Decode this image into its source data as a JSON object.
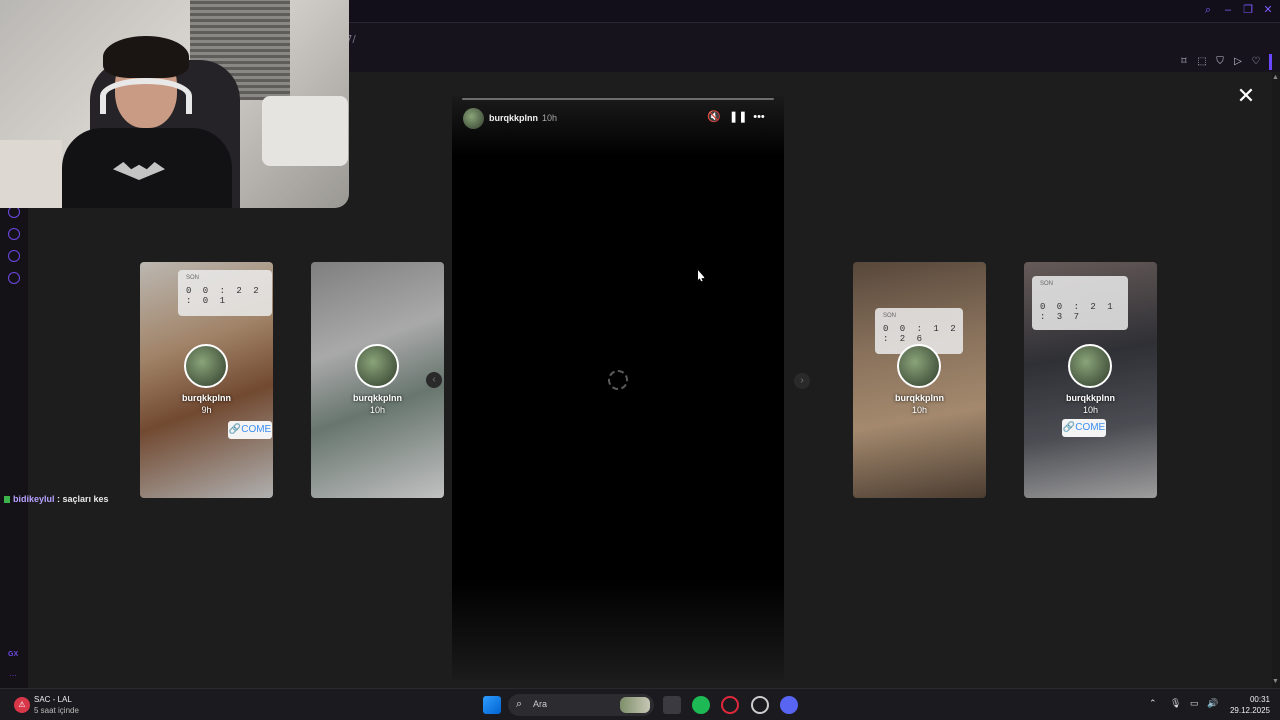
{
  "browser": {
    "address": "7/"
  },
  "chat": {
    "user": "bidikeylul",
    "separator": " : ",
    "message": "saçları kes"
  },
  "story": {
    "username": "burqkkplnn",
    "time": "10h",
    "mute_icon": "speaker-muted-icon",
    "pause_icon": "pause-icon",
    "more_icon": "more-icon"
  },
  "thumbnails": [
    {
      "username": "burqkkplnn",
      "time": "9h",
      "timer_label": "SON",
      "timer": "0 0 : 2 2 : 0 1",
      "link": "COME"
    },
    {
      "username": "burqkkplnn",
      "time": "10h",
      "timer_label": "",
      "timer": "",
      "link": ""
    },
    {
      "username": "burqkkplnn",
      "time": "10h",
      "timer_label": "SON",
      "timer": "0 0 : 1 2 : 2 6",
      "link": ""
    },
    {
      "username": "burqkkplnn",
      "time": "10h",
      "timer_label": "SON",
      "timer": "0 0 : 2 1 : 3 7",
      "link": "COME"
    }
  ],
  "taskbar": {
    "weather_title": "SAC - LAL",
    "weather_sub": "5 saat içinde",
    "search_placeholder": "Ara",
    "time": "00:31",
    "date": "29.12.2025"
  },
  "colors": {
    "accent": "#6e48e8",
    "chat_user": "#b5a1ff",
    "link_blue": "#3d8ef0"
  }
}
